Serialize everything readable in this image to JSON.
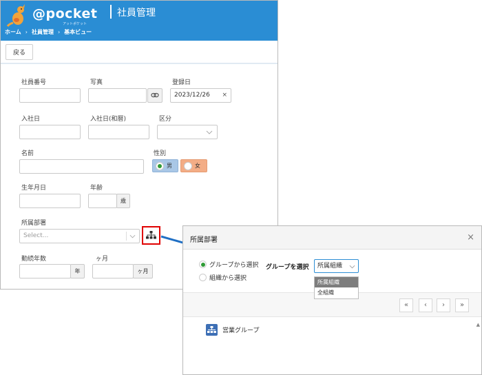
{
  "header": {
    "brand": "@pocket",
    "brand_sub": "アットポケット",
    "app_title": "社員管理",
    "breadcrumb": [
      "ホーム",
      "社員管理",
      "基本ビュー"
    ],
    "breadcrumb_sep": "›"
  },
  "toolbar": {
    "back_label": "戻る"
  },
  "form": {
    "employee_no_label": "社員番号",
    "photo_label": "写真",
    "registered_label": "登録日",
    "registered_value": "2023/12/26",
    "clear_symbol": "×",
    "join_date_label": "入社日",
    "join_date_jp_label": "入社日(和暦)",
    "category_label": "区分",
    "name_label": "名前",
    "gender_label": "性別",
    "gender_male": "男",
    "gender_female": "女",
    "birth_label": "生年月日",
    "age_label": "年齢",
    "age_unit": "歳",
    "dept_label": "所属部署",
    "dept_placeholder": "Select...",
    "years_label": "勤続年数",
    "years_unit": "年",
    "months_label": "ヶ月",
    "months_unit": "ヶ月"
  },
  "dialog": {
    "title": "所属部署",
    "close": "×",
    "radio_group": "グループから選択",
    "radio_org": "組織から選択",
    "select_group_label": "グループを選択",
    "select_value": "所属組織",
    "options": [
      "所属組織",
      "全組織"
    ],
    "nav": [
      "«",
      "‹",
      "›",
      "»"
    ],
    "tree_item": "営業グループ"
  },
  "colors": {
    "header_bg": "#2a8dd4",
    "highlight_red": "#e00000",
    "male_bg": "#a9c7e6",
    "female_bg": "#f3ad86"
  }
}
